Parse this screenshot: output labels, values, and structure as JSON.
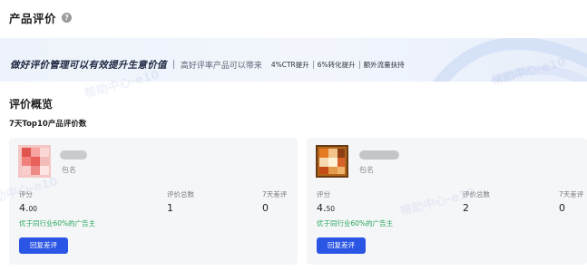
{
  "header": {
    "title": "产品评价"
  },
  "banner": {
    "slogan": "做好评价管理可以有效提升生意价值",
    "description": "高好评率产品可以带来",
    "tags": [
      "4%CTR提升",
      "6%转化提升",
      "额外流量扶持"
    ]
  },
  "overview": {
    "title": "评价概览",
    "subtitle": "7天Top10产品评价数"
  },
  "cards": [
    {
      "store_label": "包名",
      "stats": [
        {
          "label": "评分",
          "value": "4.",
          "value_small": "00"
        },
        {
          "label": "评价总数",
          "value": "1"
        },
        {
          "label": "7天差评",
          "value": "0"
        }
      ],
      "compare_text": "优于同行业60%的广告主",
      "button_label": "回复差评"
    },
    {
      "store_label": "包名",
      "stats": [
        {
          "label": "评分",
          "value": "4.",
          "value_small": "50"
        },
        {
          "label": "评价总数",
          "value": "2"
        },
        {
          "label": "7天差评",
          "value": "0"
        }
      ],
      "compare_text": "优于同行业60%的广告主",
      "button_label": "回复差评"
    }
  ],
  "watermark_text": "帮助中心-e10",
  "colors": {
    "accent_blue": "#2a55e5",
    "positive_green": "#26a65b",
    "card_bg": "#f5f6f8"
  }
}
